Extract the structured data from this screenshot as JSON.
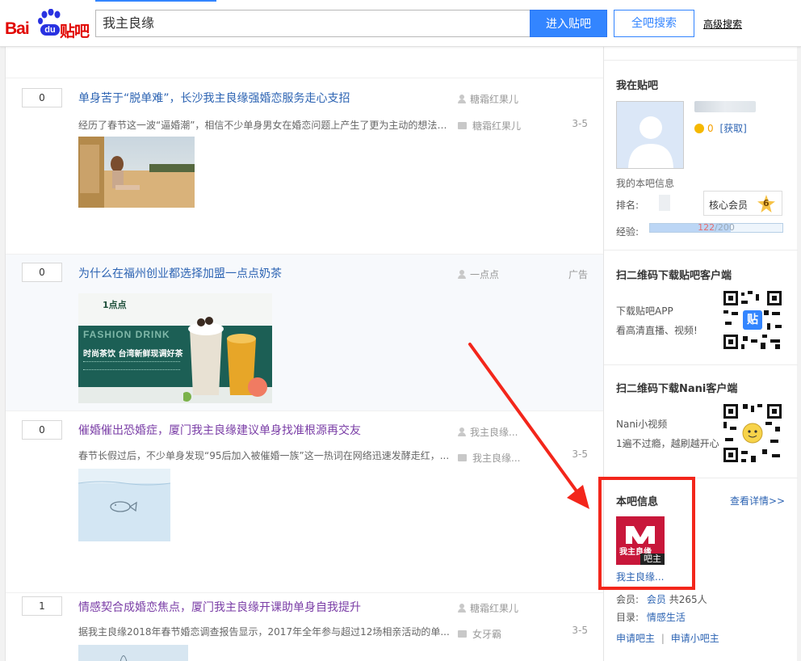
{
  "header": {
    "logo_bai": "Bai",
    "logo_du": "du",
    "logo_tieba": "贴吧",
    "search_value": "我主良缘",
    "enter_button": "进入贴吧",
    "all_search_button": "全吧搜索",
    "advanced_search": "高级搜索"
  },
  "threads": [
    {
      "reply": "0",
      "title": "单身苦于“脱单难”，长沙我主良缘强婚恋服务走心支招",
      "author": "糖霜红果儿",
      "abstract": "经历了春节这一波“逼婚潮”，相信不少单身男女在婚恋问题上产生了更为主动的想法。...",
      "last_replier": "糖霜红果儿",
      "date": "3-5"
    },
    {
      "reply": "0",
      "title": "为什么在福州创业都选择加盟一点点奶茶",
      "author": "一点点",
      "ad_label": "广告",
      "banner_brand": "1点点",
      "banner_en": "FASHION DRINK",
      "banner_slogan": "时尚茶饮 台湾新鲜现调好茶"
    },
    {
      "reply": "0",
      "title": "催婚催出恐婚症，厦门我主良缘建议单身找准根源再交友",
      "author": "我主良缘...",
      "abstract": "春节长假过后，不少单身发现“95后加入被催婚一族”这一热词在网络迅速发酵走红，...",
      "last_replier": "我主良缘...",
      "date": "3-5"
    },
    {
      "reply": "1",
      "title": "情感契合成婚恋焦点，厦门我主良缘开课助单身自我提升",
      "author": "糖霜红果儿",
      "abstract": "据我主良缘2018年春节婚恋调查报告显示，2017年全年参与超过12场相亲活动的单...",
      "last_replier": "女牙霸",
      "date": "3-5"
    }
  ],
  "aside": {
    "my_tieba": {
      "title": "我在贴吧",
      "tdou": "0",
      "get_link": "[获取]",
      "my_info": "我的本吧信息",
      "rank_label": "排名:",
      "member_label": "核心会员",
      "level": "6",
      "exp_label": "经验:",
      "exp_current": "122",
      "exp_total": "200",
      "exp_progress": 0.61
    },
    "qr_tieba": {
      "title": "扫二维码下载贴吧客户端",
      "line1": "下载贴吧APP",
      "line2": "看高清直播、视频!",
      "badge": "贴"
    },
    "qr_nani": {
      "title": "扫二维码下载Nani客户端",
      "line1": "Nani小视频",
      "line2": "1遍不过瘾，越刷越开心"
    },
    "bar_info": {
      "title": "本吧信息",
      "detail_link": "查看详情>>",
      "logo_text": "我主良缘",
      "owner_badge": "吧主",
      "bar_name": "我主良缘...",
      "member_label": "会员:",
      "member_link": "会员",
      "member_count": "共265人",
      "dir_label": "目录:",
      "dir_link": "情感生活",
      "apply_owner": "申请吧主",
      "separator": "|",
      "apply_small_owner": "申请小吧主"
    }
  },
  "colors": {
    "accent": "#3385ff",
    "link": "#2d64b3",
    "annotation_red": "#f3261b"
  }
}
